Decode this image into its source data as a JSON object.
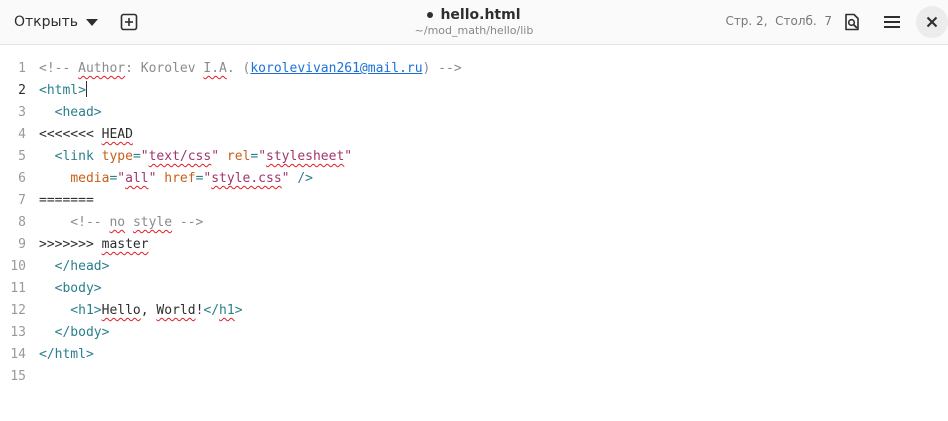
{
  "header": {
    "open_label": "Открыть",
    "title": "hello.html",
    "path": "~/mod_math/hello/lib",
    "cursor_position": "Стр. 2,  Столб.  7",
    "modified": true
  },
  "icons": {
    "new_tab": "plus-square-icon",
    "search": "search-document-icon",
    "menu": "hamburger-menu-icon",
    "close": "close-icon"
  },
  "editor": {
    "current_line": 2,
    "lines": [
      {
        "n": "1",
        "tokens": [
          {
            "t": "<!-- ",
            "c": "comment"
          },
          {
            "t": "Author",
            "c": "comment",
            "spell": true
          },
          {
            "t": ": Korolev ",
            "c": "comment"
          },
          {
            "t": "I.A",
            "c": "comment",
            "spell": true
          },
          {
            "t": ". (",
            "c": "comment"
          },
          {
            "t": "korolevivan261@mail.ru",
            "c": "link"
          },
          {
            "t": ") -->",
            "c": "comment"
          }
        ]
      },
      {
        "n": "2",
        "tokens": [
          {
            "t": "<html>",
            "c": "tag"
          }
        ]
      },
      {
        "n": "3",
        "tokens": [
          {
            "t": "  <head>",
            "c": "tag"
          }
        ]
      },
      {
        "n": "4",
        "tokens": [
          {
            "t": "<<<<<<< ",
            "c": "text"
          },
          {
            "t": "HEAD",
            "c": "text",
            "spell": true
          }
        ]
      },
      {
        "n": "5",
        "tokens": [
          {
            "t": "  <link ",
            "c": "tag"
          },
          {
            "t": "type",
            "c": "attr"
          },
          {
            "t": "=",
            "c": "tag"
          },
          {
            "t": "\"",
            "c": "str"
          },
          {
            "t": "text/css",
            "c": "str",
            "spell": true
          },
          {
            "t": "\" ",
            "c": "str"
          },
          {
            "t": "rel",
            "c": "attr"
          },
          {
            "t": "=",
            "c": "tag"
          },
          {
            "t": "\"",
            "c": "str"
          },
          {
            "t": "stylesheet",
            "c": "str",
            "spell": true
          },
          {
            "t": "\"",
            "c": "str"
          }
        ]
      },
      {
        "n": "6",
        "tokens": [
          {
            "t": "    ",
            "c": "tag"
          },
          {
            "t": "media",
            "c": "attr"
          },
          {
            "t": "=",
            "c": "tag"
          },
          {
            "t": "\"",
            "c": "str"
          },
          {
            "t": "all",
            "c": "str",
            "spell": true
          },
          {
            "t": "\" ",
            "c": "str"
          },
          {
            "t": "href",
            "c": "attr"
          },
          {
            "t": "=",
            "c": "tag"
          },
          {
            "t": "\"",
            "c": "str"
          },
          {
            "t": "style.css",
            "c": "str",
            "spell": true
          },
          {
            "t": "\" ",
            "c": "str"
          },
          {
            "t": "/>",
            "c": "tag"
          }
        ]
      },
      {
        "n": "7",
        "tokens": [
          {
            "t": "=======",
            "c": "text"
          }
        ]
      },
      {
        "n": "8",
        "tokens": [
          {
            "t": "    <!-- ",
            "c": "comment"
          },
          {
            "t": "no",
            "c": "comment",
            "spell": true
          },
          {
            "t": " ",
            "c": "comment"
          },
          {
            "t": "style",
            "c": "comment",
            "spell": true
          },
          {
            "t": " -->",
            "c": "comment"
          }
        ]
      },
      {
        "n": "9",
        "tokens": [
          {
            "t": ">>>>>>> ",
            "c": "text"
          },
          {
            "t": "master",
            "c": "text",
            "spell": true
          }
        ]
      },
      {
        "n": "10",
        "tokens": [
          {
            "t": "  </head>",
            "c": "tag"
          }
        ]
      },
      {
        "n": "11",
        "tokens": [
          {
            "t": "  <body>",
            "c": "tag"
          }
        ]
      },
      {
        "n": "12",
        "tokens": [
          {
            "t": "    <h1>",
            "c": "tag"
          },
          {
            "t": "Hello",
            "c": "text",
            "spell": true
          },
          {
            "t": ", ",
            "c": "text"
          },
          {
            "t": "World",
            "c": "text",
            "spell": true
          },
          {
            "t": "!",
            "c": "text"
          },
          {
            "t": "</",
            "c": "tag"
          },
          {
            "t": "h1",
            "c": "tag",
            "spell": true
          },
          {
            "t": ">",
            "c": "tag"
          }
        ]
      },
      {
        "n": "13",
        "tokens": [
          {
            "t": "  </body>",
            "c": "tag"
          }
        ]
      },
      {
        "n": "14",
        "tokens": [
          {
            "t": "</html>",
            "c": "tag"
          }
        ]
      },
      {
        "n": "15",
        "tokens": []
      }
    ]
  }
}
